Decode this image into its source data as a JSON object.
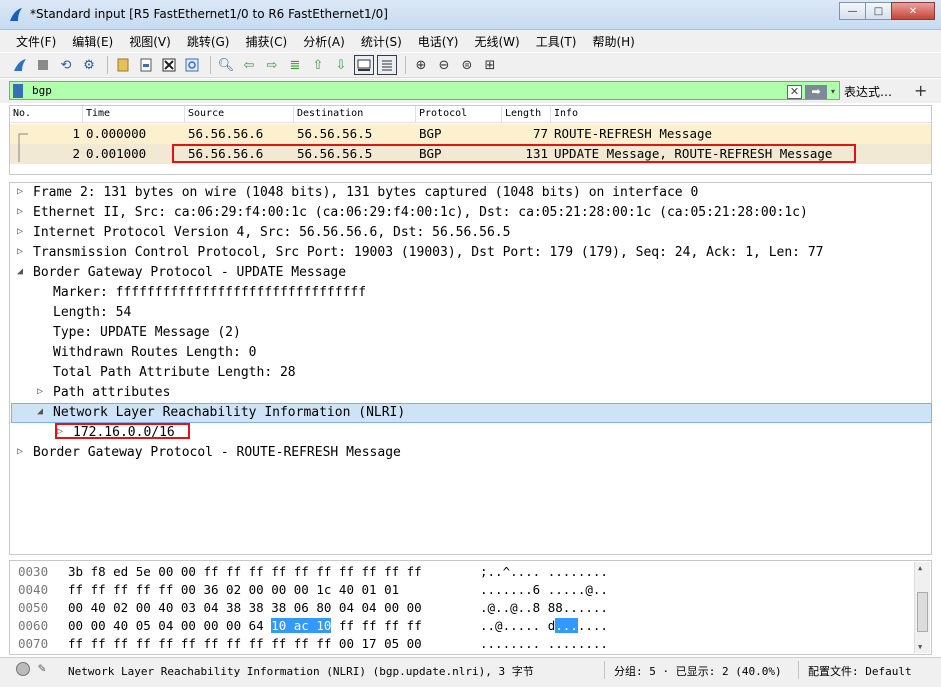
{
  "window": {
    "title": "*Standard input [R5 FastEthernet1/0 to R6 FastEthernet1/0]",
    "min": "—",
    "max": "□",
    "close": "✕"
  },
  "menu": [
    "文件(F)",
    "编辑(E)",
    "视图(V)",
    "跳转(G)",
    "捕获(C)",
    "分析(A)",
    "统计(S)",
    "电话(Y)",
    "无线(W)",
    "工具(T)",
    "帮助(H)"
  ],
  "toolbar": {
    "icons": [
      "shark-fin-icon",
      "stop-icon",
      "restart-icon",
      "options-gear-icon",
      "open-file-icon",
      "save-file-icon",
      "close-file-icon",
      "reload-icon",
      "find-icon",
      "go-back-icon",
      "go-forward-icon",
      "go-to-packet-icon",
      "go-first-icon",
      "go-last-icon",
      "autoscroll-icon",
      "colorize-icon",
      "zoom-in-icon",
      "zoom-out-icon",
      "normal-size-icon",
      "resize-columns-icon"
    ]
  },
  "filter": {
    "value": "bgp",
    "clear": "✕",
    "apply": "➡",
    "dropdown": "▾",
    "expression_label": "表达式…",
    "add_label": "+"
  },
  "packet_list": {
    "columns": [
      "No.",
      "Time",
      "Source",
      "Destination",
      "Protocol",
      "Length",
      "Info"
    ],
    "rows": [
      {
        "no": "1",
        "time": "0.000000",
        "source": "56.56.56.6",
        "destination": "56.56.56.5",
        "protocol": "BGP",
        "length": "77",
        "info": "ROUTE-REFRESH Message"
      },
      {
        "no": "2",
        "time": "0.001000",
        "source": "56.56.56.6",
        "destination": "56.56.56.5",
        "protocol": "BGP",
        "length": "131",
        "info": "UPDATE Message, ROUTE-REFRESH Message"
      }
    ]
  },
  "details": [
    {
      "arrow": "▷",
      "text": "Frame 2: 131 bytes on wire (1048 bits), 131 bytes captured (1048 bits) on interface 0"
    },
    {
      "arrow": "▷",
      "text": "Ethernet II, Src: ca:06:29:f4:00:1c (ca:06:29:f4:00:1c), Dst: ca:05:21:28:00:1c (ca:05:21:28:00:1c)"
    },
    {
      "arrow": "▷",
      "text": "Internet Protocol Version 4, Src: 56.56.56.6, Dst: 56.56.56.5"
    },
    {
      "arrow": "▷",
      "text": "Transmission Control Protocol, Src Port: 19003 (19003), Dst Port: 179 (179), Seq: 24, Ack: 1, Len: 77"
    },
    {
      "arrow": "◢",
      "text": "Border Gateway Protocol - UPDATE Message"
    },
    {
      "arrow": "",
      "text": "Marker: ffffffffffffffffffffffffffffffff"
    },
    {
      "arrow": "",
      "text": "Length: 54"
    },
    {
      "arrow": "",
      "text": "Type: UPDATE Message (2)"
    },
    {
      "arrow": "",
      "text": "Withdrawn Routes Length: 0"
    },
    {
      "arrow": "",
      "text": "Total Path Attribute Length: 28"
    },
    {
      "arrow": "▷",
      "text": "Path attributes"
    },
    {
      "arrow": "◢",
      "text": "Network Layer Reachability Information (NLRI)"
    },
    {
      "arrow": "▷",
      "text": "172.16.0.0/16"
    },
    {
      "arrow": "▷",
      "text": "Border Gateway Protocol - ROUTE-REFRESH Message"
    }
  ],
  "hex": [
    {
      "offset": "0030",
      "bytes_a": "3b f8 ed 5e 00 00 ff ff  ff ff ff ff ff ff ff ff",
      "bytes_sel": "",
      "bytes_b": "",
      "ascii_a": ";..^.... ........",
      "ascii_sel": "",
      "ascii_b": ""
    },
    {
      "offset": "0040",
      "bytes_a": "ff ff ff ff ff 00 36  02 00 00 00 1c 40 01 01",
      "bytes_sel": "",
      "bytes_b": "",
      "ascii_a": ".......6 .....@..",
      "ascii_sel": "",
      "ascii_b": ""
    },
    {
      "offset": "0050",
      "bytes_a": "00 40 02 00 40 03 04 38  38 38 06 80 04 04 00 00",
      "bytes_sel": "",
      "bytes_b": "",
      "ascii_a": ".@..@..8 88......",
      "ascii_sel": "",
      "ascii_b": ""
    },
    {
      "offset": "0060",
      "bytes_a": "00 00 40 05 04 00 00 00  64 ",
      "bytes_sel": "10 ac 10",
      "bytes_b": " ff ff ff ff",
      "ascii_a": "..@..... d",
      "ascii_sel": "...",
      "ascii_b": "...."
    },
    {
      "offset": "0070",
      "bytes_a": "ff ff ff ff ff ff ff ff  ff ff ff ff 00 17 05 00",
      "bytes_sel": "",
      "bytes_b": "",
      "ascii_a": "........ ........",
      "ascii_sel": "",
      "ascii_b": ""
    }
  ],
  "status": {
    "field_info": "Network Layer Reachability Information (NLRI) (bgp.update.nlri), 3 字节",
    "packets": "分组: 5 · 已显示: 2 (40.0%)",
    "profile": "配置文件: Default"
  },
  "colors": {
    "filter_valid_bg": "#afffaf",
    "row1_bg": "#fdf0cf",
    "row2_bg": "#f1e9d3",
    "selection_blue": "#3399ff",
    "highlight_box": "#e01414"
  }
}
